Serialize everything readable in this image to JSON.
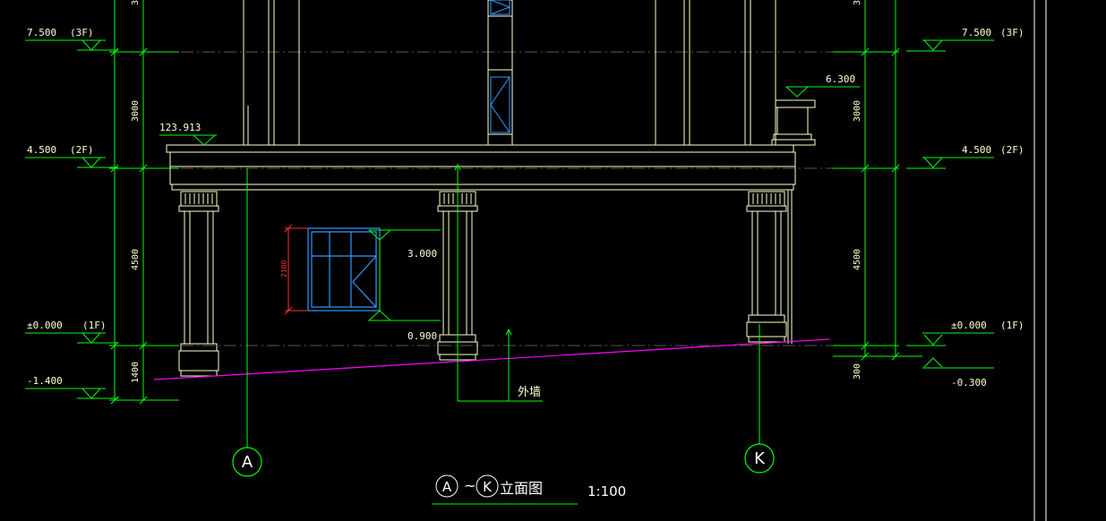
{
  "drawing": {
    "title": "立面图",
    "title_axis_from": "A",
    "title_axis_to": "K",
    "title_separator": "~",
    "scale": "1:100",
    "background_color": "#000000",
    "colors": {
      "dimension": "#00ff00",
      "building": "#ffffcc",
      "text": "#ffffff",
      "grade_line": "#ff00ff",
      "window_frame": "#3399ff",
      "window_dim": "#ff3333",
      "ref_line": "#888888"
    }
  },
  "levels_left": [
    {
      "elev": "7.500",
      "floor": "(3F)"
    },
    {
      "elev": "4.500",
      "floor": "(2F)"
    },
    {
      "elev": "±0.000",
      "floor": "(1F)"
    },
    {
      "elev": "-1.400",
      "floor": ""
    }
  ],
  "levels_right": [
    {
      "elev": "7.500",
      "floor": "(3F)"
    },
    {
      "elev": "4.500",
      "floor": "(2F)"
    },
    {
      "elev": "±0.000",
      "floor": "(1F)"
    },
    {
      "elev": "-0.300",
      "floor": ""
    }
  ],
  "dims_left": [
    "3000",
    "4500",
    "1400"
  ],
  "dims_right": [
    "3000",
    "4500",
    "300"
  ],
  "annotations": {
    "roof_elev": "123.913",
    "canopy_elev": "6.300",
    "window_top": "3.000",
    "window_sill": "0.900",
    "window_height": "2100",
    "wall_label": "外墙"
  },
  "axes": [
    "A",
    "K"
  ]
}
